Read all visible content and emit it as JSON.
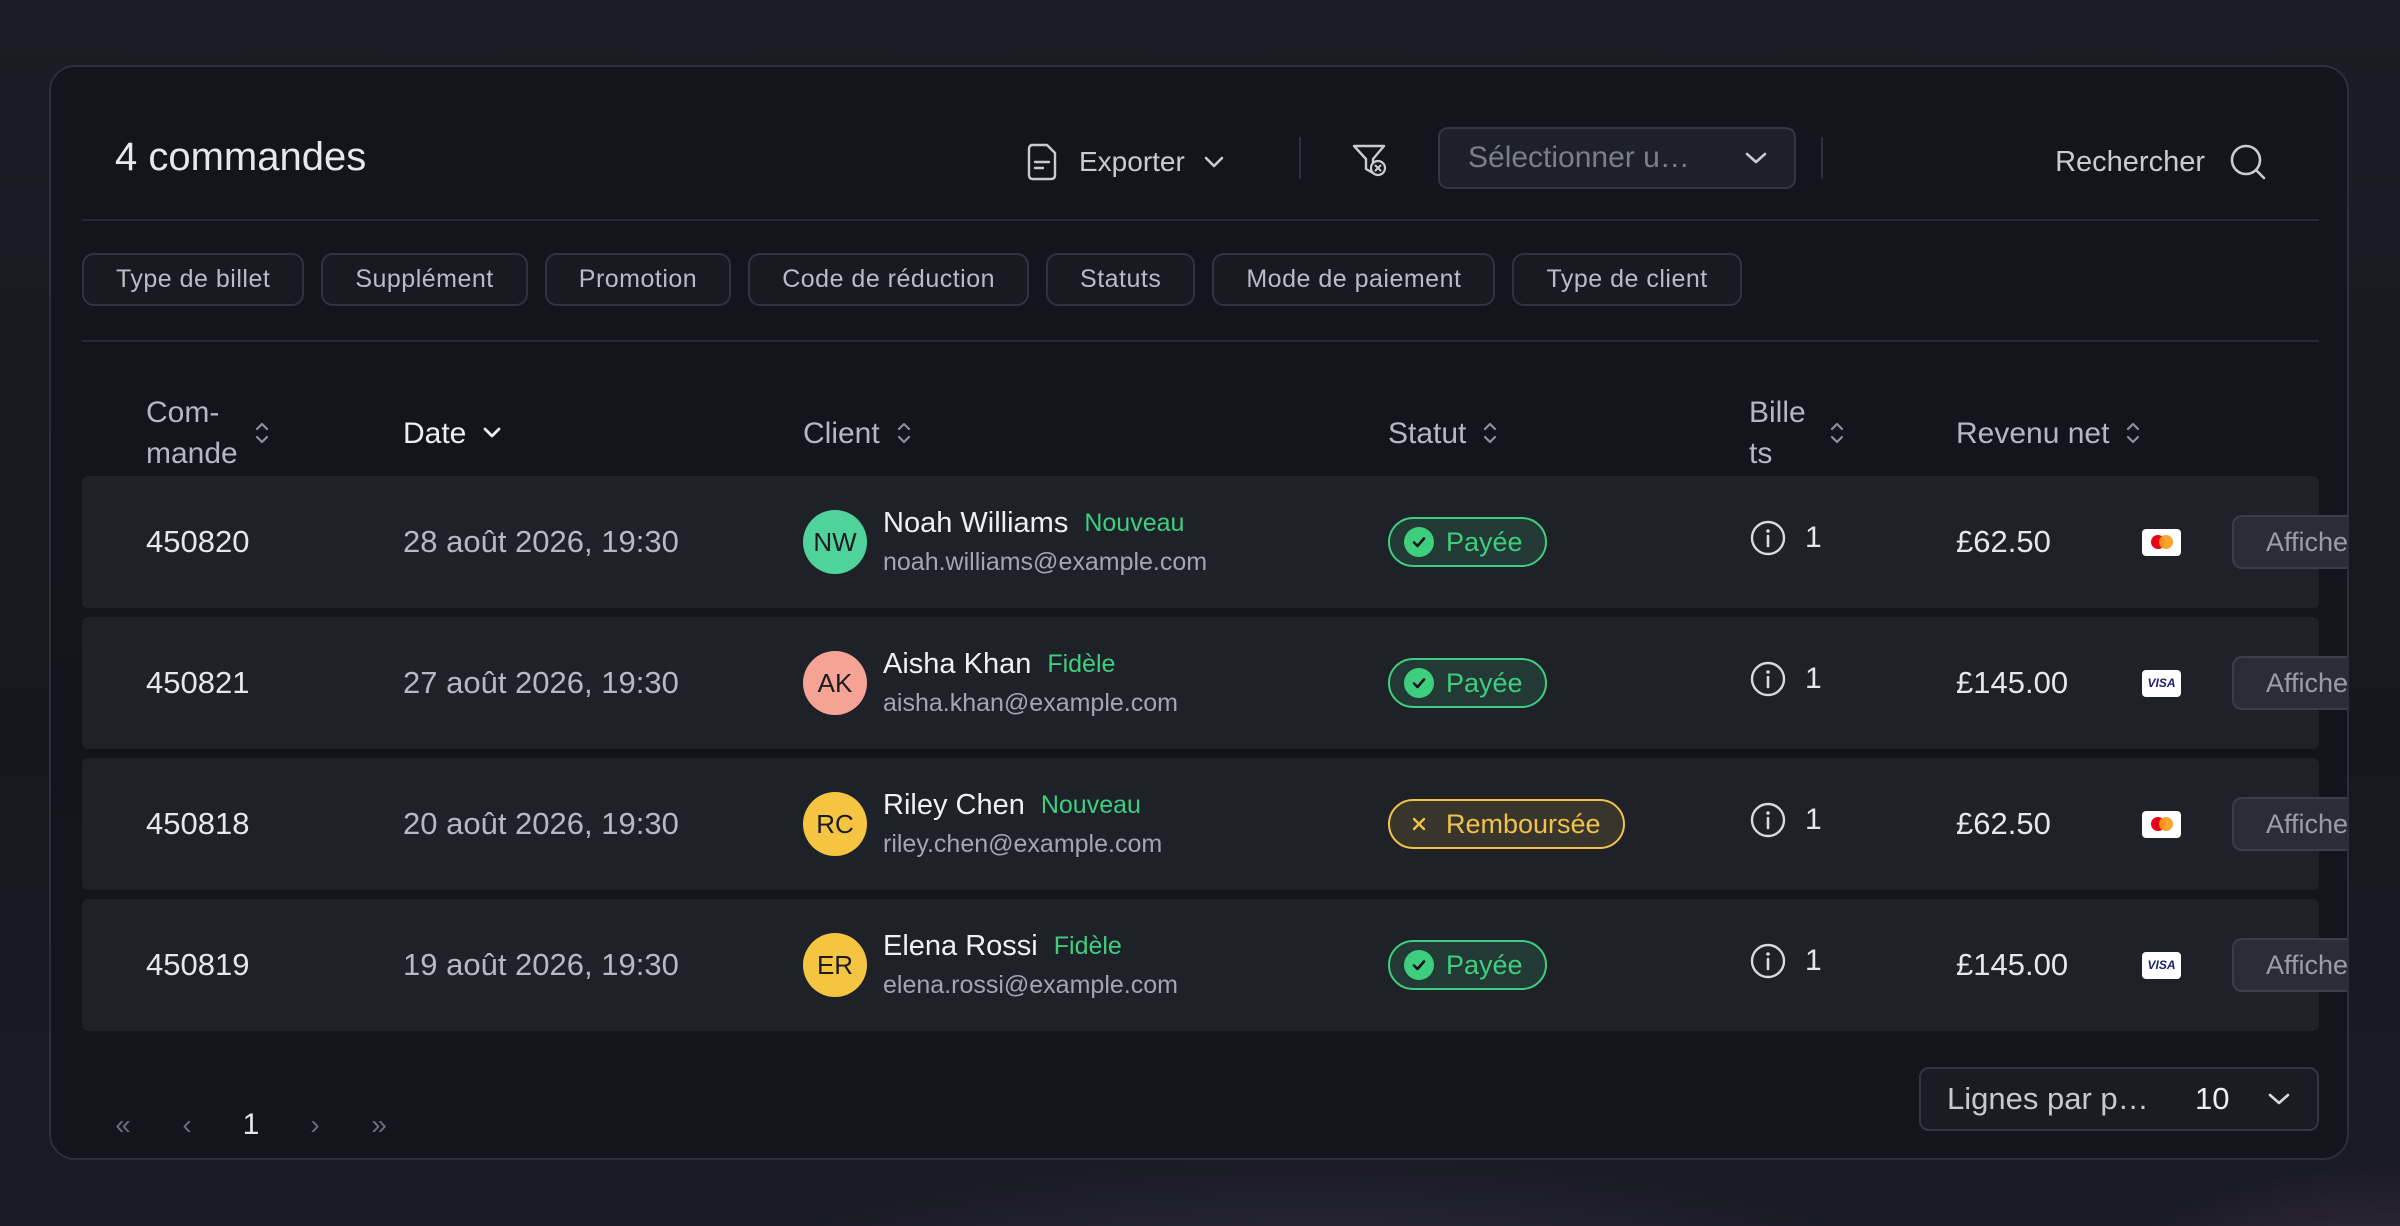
{
  "header": {
    "title": "4 commandes",
    "export_label": "Exporter",
    "select_placeholder": "Sélectionner u…",
    "search_label": "Rechercher"
  },
  "filters": [
    "Type de billet",
    "Supplément",
    "Promotion",
    "Code de réduction",
    "Statuts",
    "Mode de paiement",
    "Type de client"
  ],
  "table": {
    "columns": {
      "order": "Com-\nmande",
      "date": "Date",
      "client": "Client",
      "status": "Statut",
      "tickets": "Bille\nts",
      "revenue": "Revenu net"
    },
    "view_label": "Afficher",
    "rows": [
      {
        "order": "450820",
        "date": "28 août 2026, 19:30",
        "initials": "NW",
        "avatar_color": "#4fd39a",
        "name": "Noah Williams",
        "tag": "Nouveau",
        "email": "noah.williams@example.com",
        "status": "Payée",
        "status_type": "paid",
        "tickets": "1",
        "revenue": "£62.50",
        "payment_icon": "mastercard-icon"
      },
      {
        "order": "450821",
        "date": "27 août 2026, 19:30",
        "initials": "AK",
        "avatar_color": "#f5a395",
        "name": "Aisha Khan",
        "tag": "Fidèle",
        "email": "aisha.khan@example.com",
        "status": "Payée",
        "status_type": "paid",
        "tickets": "1",
        "revenue": "£145.00",
        "payment_icon": "visa-icon"
      },
      {
        "order": "450818",
        "date": "20 août 2026, 19:30",
        "initials": "RC",
        "avatar_color": "#f5c542",
        "name": "Riley Chen",
        "tag": "Nouveau",
        "email": "riley.chen@example.com",
        "status": "Remboursée",
        "status_type": "refund",
        "tickets": "1",
        "revenue": "£62.50",
        "payment_icon": "mastercard-icon"
      },
      {
        "order": "450819",
        "date": "19 août 2026, 19:30",
        "initials": "ER",
        "avatar_color": "#f5c542",
        "name": "Elena Rossi",
        "tag": "Fidèle",
        "email": "elena.rossi@example.com",
        "status": "Payée",
        "status_type": "paid",
        "tickets": "1",
        "revenue": "£145.00",
        "payment_icon": "visa-icon"
      }
    ]
  },
  "pagination": {
    "first": "«",
    "prev": "‹",
    "current": "1",
    "next": "›",
    "last": "»",
    "rows_per_page_label": "Lignes par p…",
    "rows_per_page_value": "10"
  },
  "colors": {
    "accent_green": "#3ecf7e",
    "accent_yellow": "#f2c24a"
  }
}
